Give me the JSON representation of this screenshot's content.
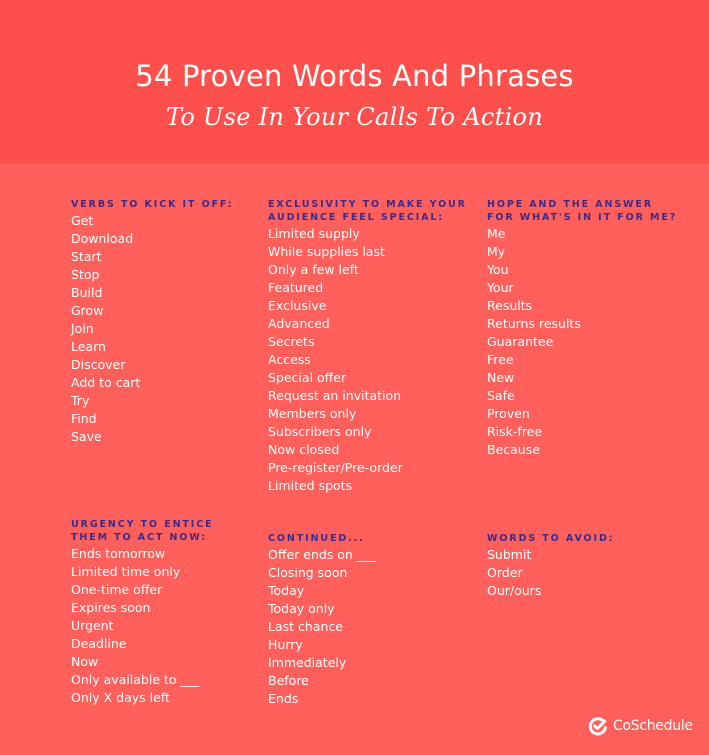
{
  "colors": {
    "header_bg": "#fd504d",
    "body_bg": "#ff605c",
    "heading": "#3a2b8c",
    "text": "#ffffff"
  },
  "header": {
    "title": "54 Proven Words And Phrases",
    "subtitle": "To Use In Your Calls To Action"
  },
  "sections": [
    {
      "heading_lines": [
        "Verbs to kick it off:"
      ],
      "items": [
        "Get",
        "Download",
        "Start",
        "Stop",
        "Build",
        "Grow",
        "Join",
        "Learn",
        "Discover",
        "Add to cart",
        "Try",
        "Find",
        "Save"
      ]
    },
    {
      "heading_lines": [
        "Exclusivity to make your",
        "audience feel special:"
      ],
      "items": [
        "Limited supply",
        "While supplies last",
        "Only a few left",
        "Featured",
        "Exclusive",
        "Advanced",
        "Secrets",
        "Access",
        "Special offer",
        "Request an invitation",
        "Members only",
        "Subscribers only",
        "Now closed",
        "Pre-register/Pre-order",
        "Limited spots"
      ]
    },
    {
      "heading_lines": [
        "Hope and the answer",
        "for what's in it for me?"
      ],
      "items": [
        "Me",
        "My",
        "You",
        "Your",
        "Results",
        "Returns results",
        "Guarantee",
        "Free",
        "New",
        "Safe",
        "Proven",
        "Risk-free",
        "Because"
      ]
    },
    {
      "heading_lines": [
        "Urgency to entice",
        "them to act now:"
      ],
      "items": [
        "Ends tomorrow",
        "Limited time only",
        "One-time offer",
        "Expires soon",
        "Urgent",
        "Deadline",
        "Now",
        "Only available to ___",
        "Only X days left"
      ]
    },
    {
      "heading_lines": [
        "Continued..."
      ],
      "items": [
        "Offer ends on ___",
        "Closing soon",
        "Today",
        "Today only",
        "Last chance",
        "Hurry",
        "Immediately",
        "Before",
        "Ends"
      ]
    },
    {
      "heading_lines": [
        "Words to avoid:"
      ],
      "items": [
        "Submit",
        "Order",
        "Our/ours"
      ]
    }
  ],
  "logo": {
    "icon": "checkmark-circle-icon",
    "text": "CoSchedule"
  }
}
